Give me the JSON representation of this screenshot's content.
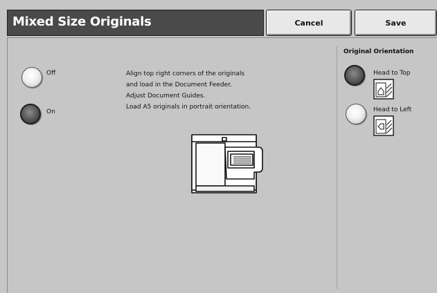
{
  "header": {
    "title": "Mixed Size Originals",
    "cancel_label": "Cancel",
    "save_label": "Save"
  },
  "mixed_size": {
    "options": [
      {
        "label": "Off",
        "selected": false
      },
      {
        "label": "On",
        "selected": true
      }
    ]
  },
  "instructions": {
    "lines": [
      "Align top right corners of the originals",
      "and load in the Document Feeder.",
      "Adjust Document Guides.",
      "Load A5 originals in portrait orientation."
    ]
  },
  "orientation": {
    "title": "Original Orientation",
    "options": [
      {
        "label": "Head to Top",
        "selected": true,
        "icon": "head-to-top-icon"
      },
      {
        "label": "Head to Left",
        "selected": false,
        "icon": "head-to-left-icon"
      }
    ]
  },
  "colors": {
    "background": "#c6c6c6",
    "title_bar": "#4a4a4a",
    "button": "#e8e8e8",
    "radio_selected": "#4a4a4a"
  }
}
